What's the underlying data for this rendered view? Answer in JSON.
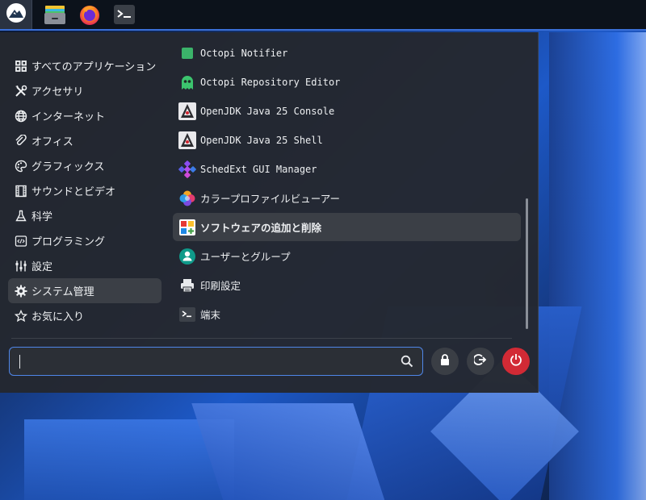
{
  "taskbar": {
    "launcher_icon": "distro-logo-icon",
    "pinned": [
      {
        "name": "file-manager-icon"
      },
      {
        "name": "firefox-icon"
      },
      {
        "name": "terminal-icon"
      }
    ]
  },
  "menu": {
    "categories": [
      {
        "label": "すべてのアプリケーション",
        "icon": "grid-icon"
      },
      {
        "label": "アクセサリ",
        "icon": "tools-icon"
      },
      {
        "label": "インターネット",
        "icon": "globe-icon"
      },
      {
        "label": "オフィス",
        "icon": "paperclip-icon"
      },
      {
        "label": "グラフィックス",
        "icon": "palette-icon"
      },
      {
        "label": "サウンドとビデオ",
        "icon": "film-icon"
      },
      {
        "label": "科学",
        "icon": "flask-icon"
      },
      {
        "label": "プログラミング",
        "icon": "code-icon"
      },
      {
        "label": "設定",
        "icon": "sliders-icon"
      },
      {
        "label": "システム管理",
        "icon": "gear-icon",
        "active": true
      },
      {
        "label": "お気に入り",
        "icon": "star-icon"
      }
    ],
    "apps": [
      {
        "label": "Octopi Notifier",
        "icon": "octopi-notifier-icon",
        "mono": true
      },
      {
        "label": "Octopi Repository Editor",
        "icon": "octopi-icon",
        "mono": true
      },
      {
        "label": "OpenJDK Java 25 Console",
        "icon": "java-icon",
        "mono": true
      },
      {
        "label": "OpenJDK Java 25 Shell",
        "icon": "java-icon",
        "mono": true
      },
      {
        "label": "SchedExt GUI Manager",
        "icon": "schedext-icon",
        "mono": true
      },
      {
        "label": "カラープロファイルビューアー",
        "icon": "color-profile-icon"
      },
      {
        "label": "ソフトウェアの追加と削除",
        "icon": "software-icon",
        "active": true
      },
      {
        "label": "ユーザーとグループ",
        "icon": "users-icon"
      },
      {
        "label": "印刷設定",
        "icon": "printer-icon"
      },
      {
        "label": "端末",
        "icon": "terminal-icon"
      }
    ],
    "search": {
      "value": "",
      "placeholder": ""
    },
    "actions": [
      {
        "name": "lock-button",
        "icon": "lock-icon"
      },
      {
        "name": "logout-button",
        "icon": "logout-icon"
      },
      {
        "name": "power-button",
        "icon": "power-icon"
      }
    ]
  },
  "colors": {
    "accent": "#4f86e8",
    "power": "#d22a35",
    "menu_bg": "#24282f",
    "active_row": "#3b3f46"
  }
}
